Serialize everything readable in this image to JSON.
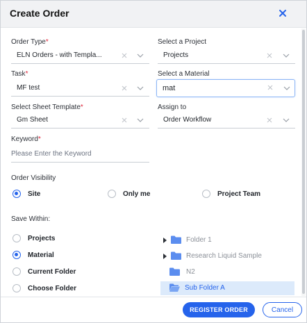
{
  "dialog": {
    "title": "Create Order"
  },
  "fields": {
    "order_type": {
      "label": "Order Type",
      "required_mark": "*",
      "value": "ELN Orders - with Templa..."
    },
    "project": {
      "label": "Select a Project",
      "value": "Projects"
    },
    "task": {
      "label": "Task",
      "required_mark": "*",
      "value": "MF test"
    },
    "material": {
      "label": "Select a Material",
      "value": "mat"
    },
    "sheet_template": {
      "label": "Select Sheet Template",
      "required_mark": "*",
      "value": "Gm Sheet"
    },
    "assign_to": {
      "label": "Assign to",
      "value": "Order Workflow"
    },
    "keyword": {
      "label": "Keyword",
      "required_mark": "*",
      "placeholder": "Please Enter the Keyword"
    }
  },
  "visibility": {
    "label": "Order Visibility",
    "options": [
      "Site",
      "Only me",
      "Project Team"
    ],
    "selected": "Site"
  },
  "save_within": {
    "label": "Save Within:",
    "options": [
      "Projects",
      "Material",
      "Current Folder",
      "Choose Folder"
    ],
    "selected": "Material"
  },
  "folder_tree": {
    "items": [
      "Folder 1",
      "Research Liquid Sample",
      "N2",
      "Sub Folder A"
    ],
    "selected": "Sub Folder A"
  },
  "footer": {
    "register_label": "REGISTER ORDER",
    "cancel_label": "Cancel"
  },
  "colors": {
    "accent": "#2563eb",
    "required": "#e0263b",
    "folder": "#5b8def",
    "selected_row": "#dceafb"
  }
}
